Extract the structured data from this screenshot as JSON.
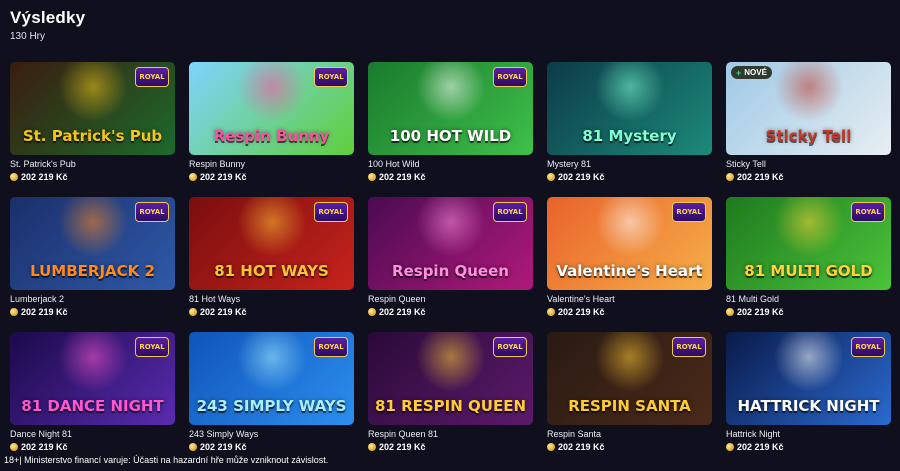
{
  "header": {
    "title": "Výsledky",
    "count": "130 Hry"
  },
  "games": [
    {
      "name": "St. Patrick's Pub",
      "jackpot": "202 219 Kč",
      "art": "St. Patrick's Pub",
      "royal": "ROYAL",
      "bg1": "#3a1c0e",
      "bg2": "#1c6b2c",
      "accent": "#f5c518"
    },
    {
      "name": "Respin Bunny",
      "jackpot": "202 219 Kč",
      "art": "Respin Bunny",
      "royal": "ROYAL",
      "bg1": "#7fd3ff",
      "bg2": "#5fcf3a",
      "accent": "#ff4fa0"
    },
    {
      "name": "100 Hot Wild",
      "jackpot": "202 219 Kč",
      "art": "100 HOT WILD",
      "royal": "ROYAL",
      "bg1": "#1a7a2e",
      "bg2": "#3fc04a",
      "accent": "#ffffff"
    },
    {
      "name": "Mystery 81",
      "jackpot": "202 219 Kč",
      "art": "81 Mystery",
      "royal": "",
      "bg1": "#0c3b48",
      "bg2": "#1d8a7a",
      "accent": "#7fffd4"
    },
    {
      "name": "Sticky Tell",
      "jackpot": "202 219 Kč",
      "art": "Sticky Tell",
      "royal": "",
      "isNew": true,
      "newLabel": "NOVÉ",
      "bg1": "#9ec9e6",
      "bg2": "#e8eef2",
      "accent": "#c0392b"
    },
    {
      "name": "Lumberjack 2",
      "jackpot": "202 219 Kč",
      "art": "LUMBERJACK 2",
      "royal": "ROYAL",
      "bg1": "#1b2f6b",
      "bg2": "#2f5aa8",
      "accent": "#ff8a1f"
    },
    {
      "name": "81 Hot Ways",
      "jackpot": "202 219 Kč",
      "art": "81 HOT WAYS",
      "royal": "ROYAL",
      "bg1": "#7a0e0e",
      "bg2": "#c7231c",
      "accent": "#ffc233"
    },
    {
      "name": "Respin Queen",
      "jackpot": "202 219 Kč",
      "art": "Respin Queen",
      "royal": "ROYAL",
      "bg1": "#4a0b52",
      "bg2": "#b0197a",
      "accent": "#ff8fe0"
    },
    {
      "name": "Valentine's Heart",
      "jackpot": "202 219 Kč",
      "art": "Valentine's Heart",
      "royal": "ROYAL",
      "bg1": "#e9622a",
      "bg2": "#f6b04a",
      "accent": "#ffffff"
    },
    {
      "name": "81 Multi Gold",
      "jackpot": "202 219 Kč",
      "art": "81 MULTI GOLD",
      "royal": "ROYAL",
      "bg1": "#1e7a1e",
      "bg2": "#4cc43a",
      "accent": "#ffd43b"
    },
    {
      "name": "Dance Night 81",
      "jackpot": "202 219 Kč",
      "art": "81 DANCE NIGHT",
      "royal": "ROYAL",
      "bg1": "#1a0a4a",
      "bg2": "#5a2bb0",
      "accent": "#ff57d0"
    },
    {
      "name": "243 Simply Ways",
      "jackpot": "202 219 Kč",
      "art": "243 SIMPLY WAYS",
      "royal": "ROYAL",
      "bg1": "#1054b8",
      "bg2": "#2c8ff0",
      "accent": "#a8f0ff"
    },
    {
      "name": "Respin Queen 81",
      "jackpot": "202 219 Kč",
      "art": "81 RESPIN QUEEN",
      "royal": "ROYAL",
      "bg1": "#2a0a3a",
      "bg2": "#5c1a6a",
      "accent": "#ffcc33"
    },
    {
      "name": "Respin Santa",
      "jackpot": "202 219 Kč",
      "art": "RESPIN SANTA",
      "royal": "ROYAL",
      "bg1": "#2a1a12",
      "bg2": "#4a2a1a",
      "accent": "#ffcc33"
    },
    {
      "name": "Hattrick Night",
      "jackpot": "202 219 Kč",
      "art": "HATTRICK NIGHT",
      "royal": "ROYAL",
      "bg1": "#0a1a4a",
      "bg2": "#2a6ad0",
      "accent": "#ffffff"
    }
  ],
  "footer": {
    "warning": "18+| Ministerstvo financí varuje: Účasti na hazardní hře může vzniknout závislost."
  }
}
